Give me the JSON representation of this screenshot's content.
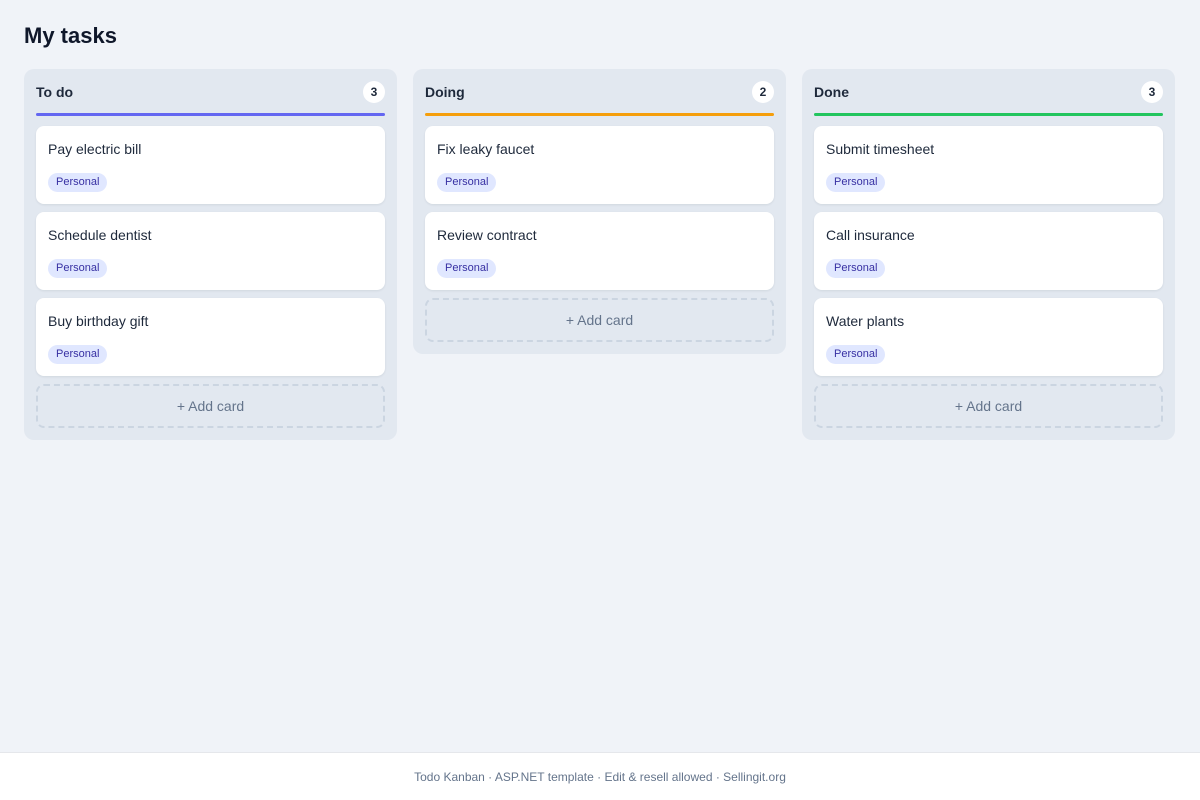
{
  "page": {
    "title": "My tasks"
  },
  "columns": [
    {
      "title": "To do",
      "count": "3",
      "accent": "#6366f1",
      "cards": [
        {
          "title": "Pay electric bill",
          "tag": "Personal"
        },
        {
          "title": "Schedule dentist",
          "tag": "Personal"
        },
        {
          "title": "Buy birthday gift",
          "tag": "Personal"
        }
      ],
      "add_label": "+ Add card"
    },
    {
      "title": "Doing",
      "count": "2",
      "accent": "#f59e0b",
      "cards": [
        {
          "title": "Fix leaky faucet",
          "tag": "Personal"
        },
        {
          "title": "Review contract",
          "tag": "Personal"
        }
      ],
      "add_label": "+ Add card"
    },
    {
      "title": "Done",
      "count": "3",
      "accent": "#22c55e",
      "cards": [
        {
          "title": "Submit timesheet",
          "tag": "Personal"
        },
        {
          "title": "Call insurance",
          "tag": "Personal"
        },
        {
          "title": "Water plants",
          "tag": "Personal"
        }
      ],
      "add_label": "+ Add card"
    }
  ],
  "footer": {
    "text": "Todo Kanban · ASP.NET template · Edit & resell allowed · Sellingit.org"
  }
}
